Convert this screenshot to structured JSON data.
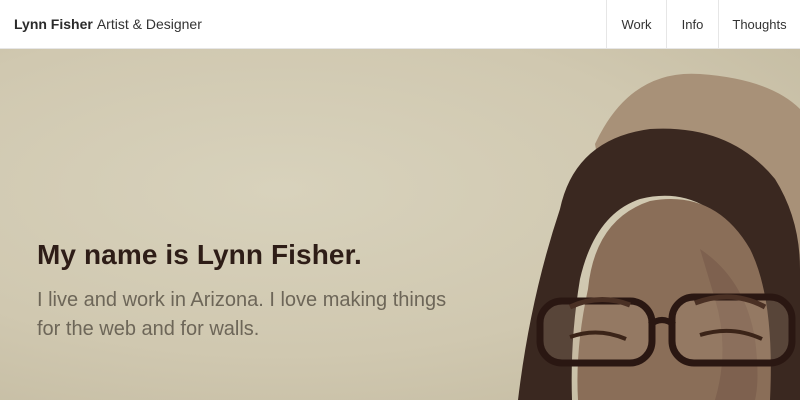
{
  "header": {
    "brand_name": "Lynn Fisher",
    "brand_tagline": "Artist & Designer",
    "nav": [
      "Work",
      "Info",
      "Thoughts"
    ]
  },
  "hero": {
    "headline": "My name is Lynn Fisher.",
    "intro": "I live and work in Arizona. I love making things for the web and for walls."
  },
  "colors": {
    "hero_background": "#d2cab2",
    "headline_text": "#2e1d17",
    "intro_text": "#6d6658",
    "hair": "#3a2820",
    "skin": "#8a6e58",
    "hood": "#a89178"
  }
}
